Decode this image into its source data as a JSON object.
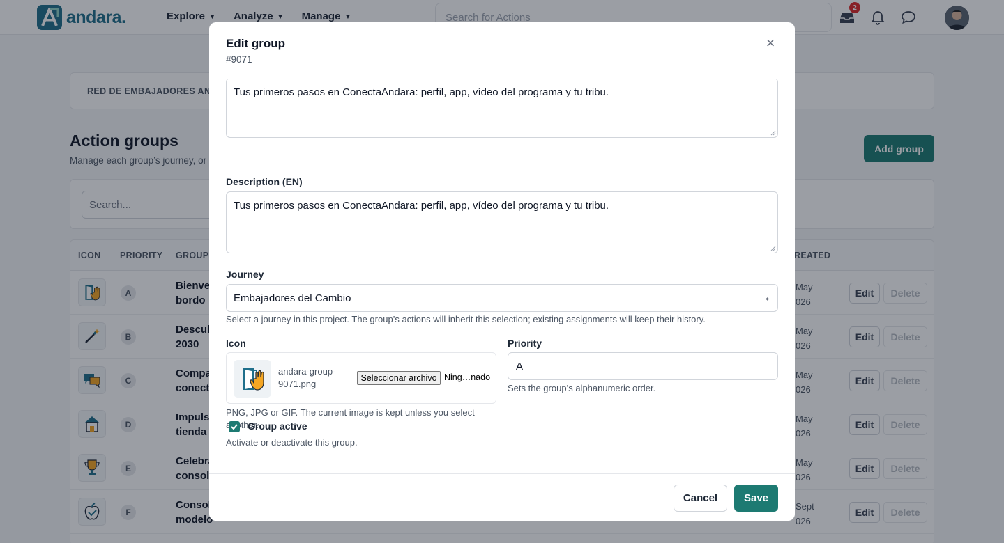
{
  "app": {
    "brand": "andara.",
    "nav": [
      {
        "label": "Explore"
      },
      {
        "label": "Analyze"
      },
      {
        "label": "Manage"
      }
    ],
    "search_placeholder": "Search for Actions",
    "inbox_badge": "2",
    "accent_color": "#1d7a72"
  },
  "page": {
    "breadcrumb": "RED DE EMBAJADORES AND",
    "title": "Action groups",
    "subtitle": "Manage each group’s journey, or",
    "add_group_label": "Add group",
    "search_placeholder": "Search...",
    "table": {
      "headers": {
        "icon": "ICON",
        "priority": "PRIORITY",
        "group": "GROUP",
        "created": "REATED"
      },
      "rows": [
        {
          "priority": "A",
          "name_l1": "Bienver",
          "name_l2": "bordo",
          "date_l1": "May",
          "date_l2": "026",
          "edit": "Edit",
          "delete": "Delete",
          "icon": "door-hand-icon"
        },
        {
          "priority": "B",
          "name_l1": "Descub",
          "name_l2": "2030",
          "date_l1": "May",
          "date_l2": "026",
          "edit": "Edit",
          "delete": "Delete",
          "icon": "magic-wand-icon"
        },
        {
          "priority": "C",
          "name_l1": "Compa",
          "name_l2": "conecta",
          "date_l1": "May",
          "date_l2": "026",
          "edit": "Edit",
          "delete": "Delete",
          "icon": "chat-bubbles-icon"
        },
        {
          "priority": "D",
          "name_l1": "Impulsa",
          "name_l2": "tienda",
          "date_l1": "May",
          "date_l2": "026",
          "edit": "Edit",
          "delete": "Delete",
          "icon": "store-icon"
        },
        {
          "priority": "E",
          "name_l1": "Celebra",
          "name_l2": "consoli",
          "date_l1": "May",
          "date_l2": "026",
          "edit": "Edit",
          "delete": "Delete",
          "icon": "trophy-icon"
        },
        {
          "priority": "F",
          "name_l1": "Consol",
          "name_l2": "modelo",
          "date_l1": "Sept",
          "date_l2": "026",
          "edit": "Edit",
          "delete": "Delete",
          "icon": "apple-check-icon"
        }
      ]
    }
  },
  "modal": {
    "title": "Edit group",
    "id": "#9071",
    "description_es_value": "Tus primeros pasos en ConectaAndara: perfil, app, vídeo del programa y tu tribu.",
    "description_en_label": "Description (EN)",
    "description_en_value": "Tus primeros pasos en ConectaAndara: perfil, app, vídeo del programa y tu tribu.",
    "journey_label": "Journey",
    "journey_value": "Embajadores del Cambio",
    "journey_help": "Select a journey in this project. The group’s actions will inherit this selection; existing assignments will keep their history.",
    "icon_label": "Icon",
    "icon_file_name": "andara-group-9071.png",
    "icon_file_button": "Seleccionar archivo",
    "icon_file_status": "Ning…nado",
    "icon_help": "PNG, JPG or GIF. The current image is kept unless you select another.",
    "priority_label": "Priority",
    "priority_value": "A",
    "priority_help": "Sets the group’s alphanumeric order.",
    "active_label": "Group active",
    "active_checked": true,
    "active_help": "Activate or deactivate this group.",
    "cancel_label": "Cancel",
    "save_label": "Save"
  }
}
